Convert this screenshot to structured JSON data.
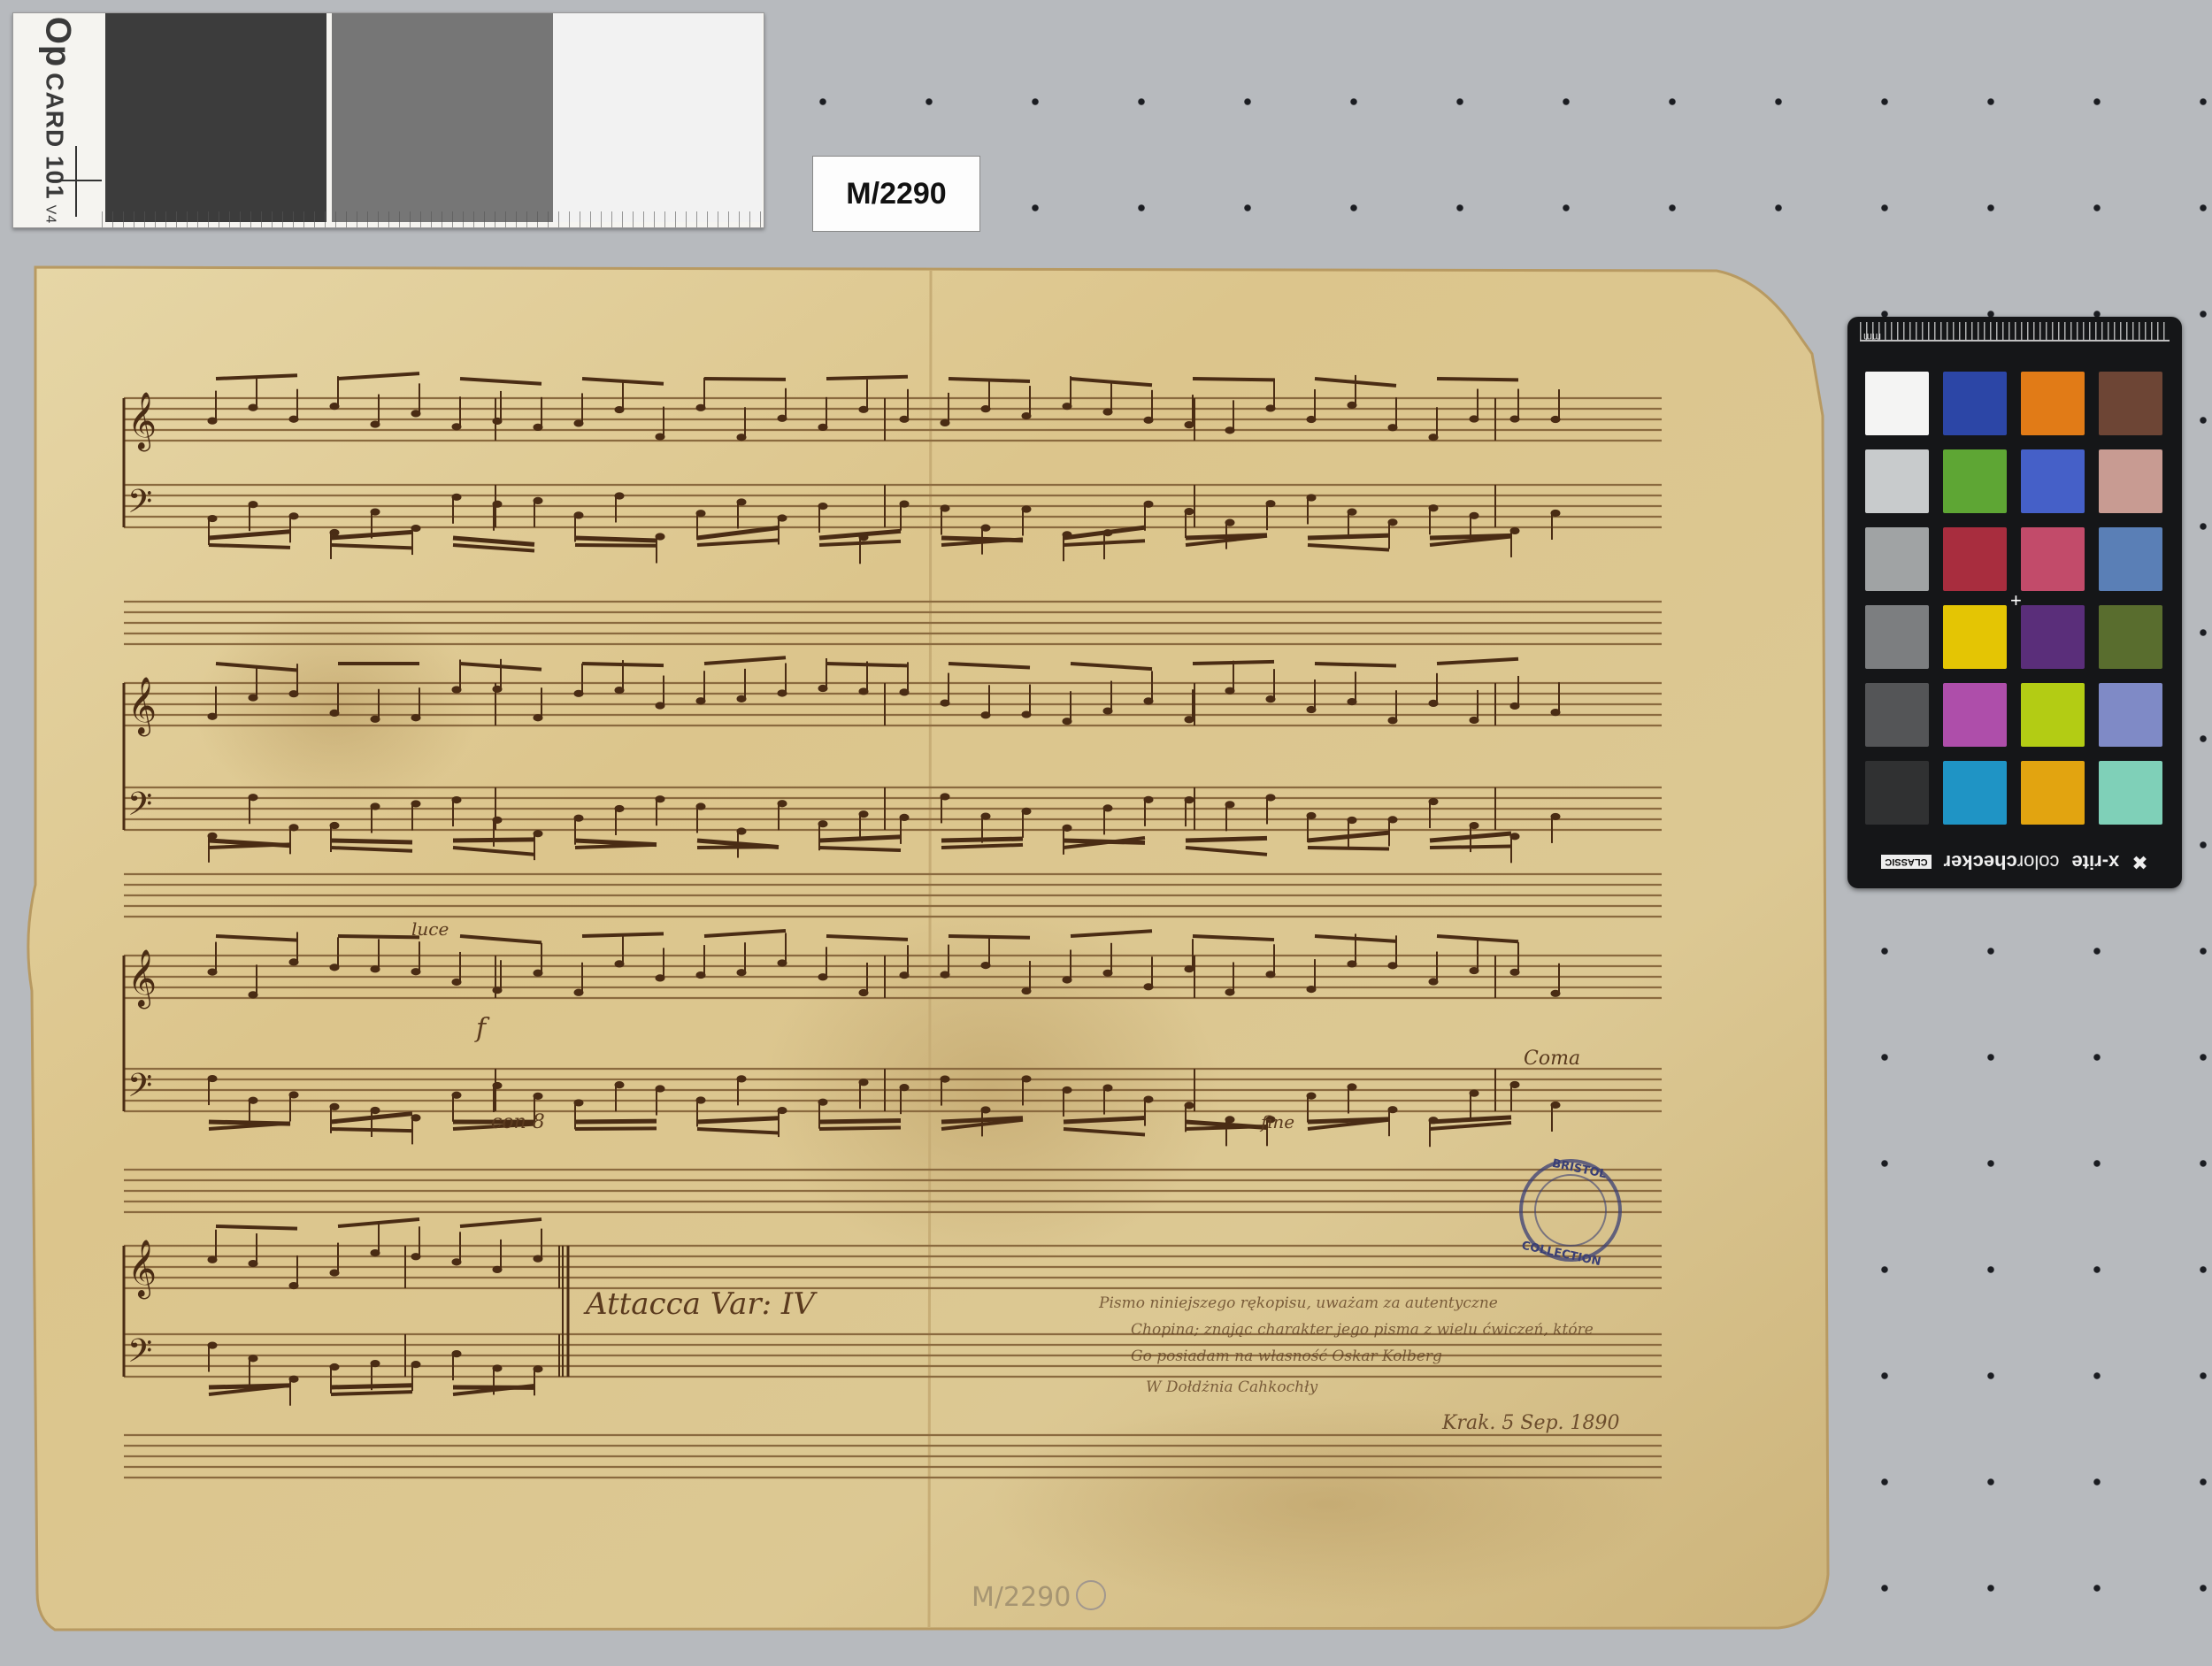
{
  "opcard": {
    "brand": "Op",
    "model": "CARD 101",
    "version": "V4",
    "swatch_colors": [
      "#3c3c3c",
      "#767676",
      "#f2f2f2"
    ]
  },
  "shelfmark_label": "M/2290",
  "manuscript": {
    "direction_note": "Attacca Var: IV",
    "dynamic_f": "f",
    "con_note": "con 8",
    "fine_note": "fine",
    "luce_note": "luce",
    "coma_note": "Coma",
    "inscription_lines": [
      "Pismo niniejszego rękopisu, uważam za autentyczne",
      "Chopina; znając charakter jego pisma z wielu ćwiczeń, które",
      "Go posiadam na własność   Oskar Kolberg",
      "W Dołdżnia Cahkochły",
      "Krak. 5 Sep. 1890"
    ],
    "stamp_text": [
      "BRISTOL",
      "COLLECTION"
    ],
    "bottom_shelfmark": "M/2290"
  },
  "colorchecker": {
    "ruler_unit": "mm",
    "brand": "x-rite",
    "product_prefix": "color",
    "product_suffix": "checker",
    "edition": "CLASSIC",
    "patches": [
      "#f4f4f3",
      "#2c46a6",
      "#e17b17",
      "#6d4535",
      "#c8cbcc",
      "#5ea634",
      "#4560c8",
      "#c89b92",
      "#a0a3a4",
      "#a82d3e",
      "#c24b6a",
      "#5a7fb6",
      "#7c7e80",
      "#e4c504",
      "#5a2e7a",
      "#596d2e",
      "#545557",
      "#ae4eaa",
      "#b3cc14",
      "#7f8ac6",
      "#303132",
      "#1f94c5",
      "#e2a410",
      "#7fd0b8"
    ]
  }
}
